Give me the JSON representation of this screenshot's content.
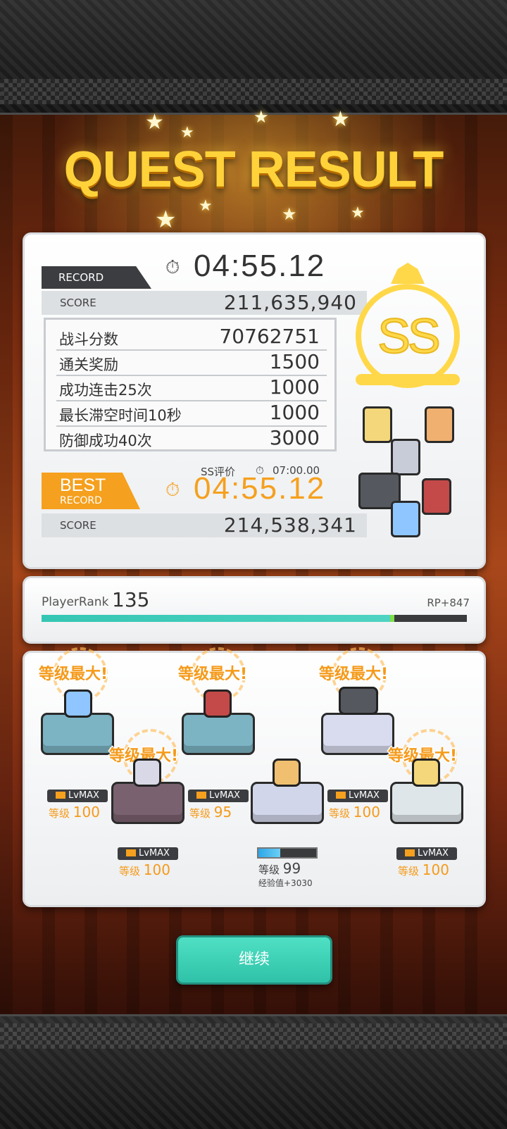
{
  "header": {
    "title": "QUEST RESULT"
  },
  "record": {
    "tag": "RECORD",
    "time": "04:55.12",
    "score_label": "SCORE",
    "score_value": "211,635,940",
    "breakdown": [
      {
        "label": "战斗分数",
        "value": "70762751"
      },
      {
        "label": "通关奖励",
        "value": "1500"
      },
      {
        "label": "成功连击25次",
        "value": "1000"
      },
      {
        "label": "最长滞空时间10秒",
        "value": "1000"
      },
      {
        "label": "防御成功40次",
        "value": "3000"
      }
    ],
    "ss_criteria_label": "SS评价",
    "ss_criteria_time": "07:00.00",
    "rank_badge": "SS"
  },
  "best": {
    "tag_line1": "BEST",
    "tag_line2": "RECORD",
    "time": "04:55.12",
    "score_label": "SCORE",
    "score_value": "214,538,341"
  },
  "player": {
    "label": "PlayerRank",
    "rank": "135",
    "rp": "RP+847",
    "progress": 0.82
  },
  "units": [
    {
      "max_label": "等级最大!",
      "lvmax": "LvMAX",
      "level_label": "等级",
      "level": "100",
      "pedestal_color": "#7cb4c4",
      "chara_color": "#8fc6ff"
    },
    {
      "max_label": "等级最大!",
      "lvmax": "LvMAX",
      "level_label": "等级",
      "level": "100",
      "pedestal_color": "#7a6170",
      "chara_color": "#d8d8e6"
    },
    {
      "max_label": "等级最大!",
      "lvmax": "LvMAX",
      "level_label": "等级",
      "level": "95",
      "pedestal_color": "#7cb4c4",
      "chara_color": "#c44a4a"
    },
    {
      "max_label": "",
      "lvmax": "",
      "level_label": "等级",
      "level": "99",
      "exp": "经验值+3030",
      "progress": 0.38,
      "pedestal_color": "#d2d6ea",
      "chara_color": "#f0c070"
    },
    {
      "max_label": "等级最大!",
      "lvmax": "LvMAX",
      "level_label": "等级",
      "level": "100",
      "pedestal_color": "#d9dcef",
      "chara_color": "#55595f"
    },
    {
      "max_label": "等级最大!",
      "lvmax": "LvMAX",
      "level_label": "等级",
      "level": "100",
      "pedestal_color": "#dfe6ea",
      "chara_color": "#f3d77a"
    }
  ],
  "continue_label": "继续",
  "colors": {
    "accent": "#f5a01e",
    "teal": "#35c6b3",
    "gold": "#ffd23a"
  },
  "icons": {
    "stopwatch": "stopwatch-icon"
  }
}
